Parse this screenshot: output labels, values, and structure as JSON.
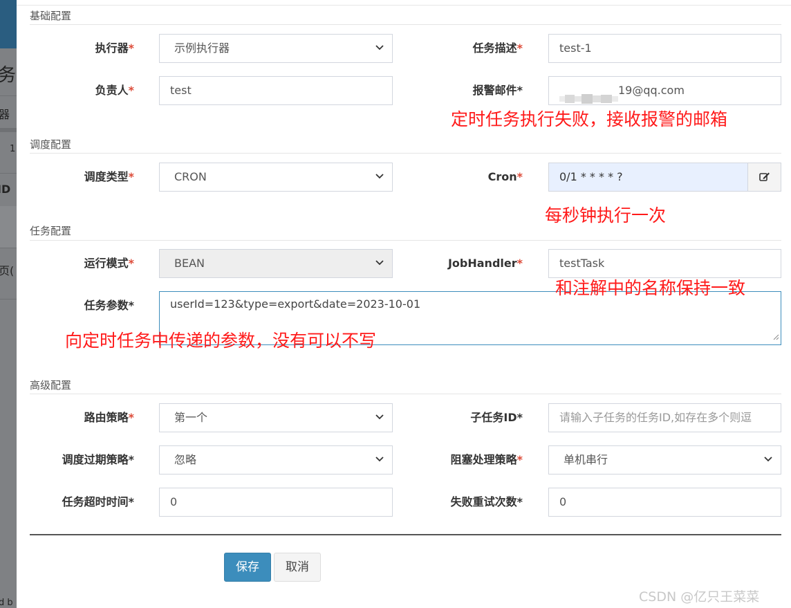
{
  "background_page": {
    "fragments": [
      "务管",
      "器",
      "1",
      "ID",
      "页(",
      "d b"
    ]
  },
  "sections": {
    "basic": "基础配置",
    "schedule": "调度配置",
    "task": "任务配置",
    "advanced": "高级配置"
  },
  "form": {
    "executor": {
      "label": "执行器",
      "value": "示例执行器"
    },
    "job_desc": {
      "label": "任务描述",
      "value": "test-1"
    },
    "author": {
      "label": "负责人",
      "value": "test"
    },
    "alarm_email": {
      "label": "报警邮件",
      "value": "19@qq.com"
    },
    "schedule_type": {
      "label": "调度类型",
      "value": "CRON"
    },
    "cron": {
      "label": "Cron",
      "value": "0/1 * * * * ?",
      "button_icon": "edit-icon"
    },
    "glue_type": {
      "label": "运行模式",
      "value": "BEAN"
    },
    "job_handler": {
      "label": "JobHandler",
      "value": "testTask"
    },
    "job_param": {
      "label": "任务参数",
      "value": "userId=123&type=export&date=2023-10-01"
    },
    "route_strategy": {
      "label": "路由策略",
      "value": "第一个"
    },
    "child_job_id": {
      "label": "子任务ID",
      "placeholder": "请输入子任务的任务ID,如存在多个则逗"
    },
    "misfire_strategy": {
      "label": "调度过期策略",
      "value": "忽略"
    },
    "block_strategy": {
      "label": "阻塞处理策略",
      "value": "单机串行"
    },
    "timeout": {
      "label": "任务超时时间",
      "value": "0"
    },
    "fail_retry": {
      "label": "失败重试次数",
      "value": "0"
    },
    "required_mark": "*"
  },
  "annotations": {
    "email_note": "定时任务执行失败，接收报警的邮箱",
    "cron_note": "每秒钟执行一次",
    "handler_note": "和注解中的名称保持一致",
    "param_note": "向定时任务中传递的参数，没有可以不写"
  },
  "buttons": {
    "save": "保存",
    "cancel": "取消"
  },
  "watermark": "CSDN @亿只王菜菜",
  "colors": {
    "primary": "#3c8dbc",
    "required": "#dd4b39",
    "annotation": "#ff1a1a",
    "cron_bg": "#e8f0fe"
  }
}
